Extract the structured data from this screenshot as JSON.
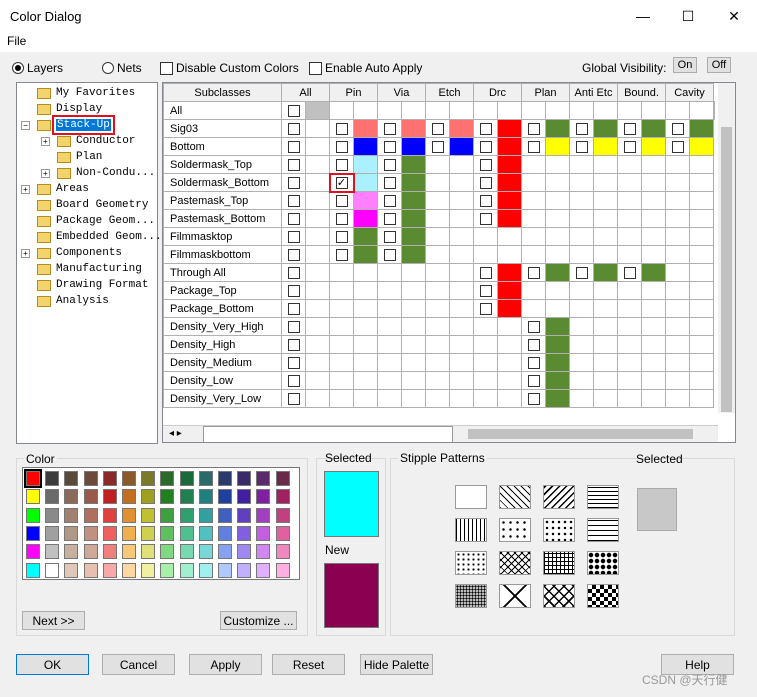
{
  "window": {
    "title": "Color Dialog",
    "menu_file": "File",
    "min": "—",
    "max": "☐",
    "close": "✕"
  },
  "options": {
    "layers": "Layers",
    "nets": "Nets",
    "disable_custom_colors": "Disable Custom Colors",
    "enable_auto_apply": "Enable Auto Apply",
    "global_visibility": "Global Visibility:",
    "on": "On",
    "off": "Off"
  },
  "tree": [
    {
      "label": "My Favorites",
      "indent": 0,
      "exp": ""
    },
    {
      "label": "Display",
      "indent": 0,
      "exp": ""
    },
    {
      "label": "Stack-Up",
      "indent": 0,
      "exp": "−",
      "selected": true
    },
    {
      "label": "Conductor",
      "indent": 1,
      "exp": "+"
    },
    {
      "label": "Plan",
      "indent": 1,
      "exp": ""
    },
    {
      "label": "Non-Condu...",
      "indent": 1,
      "exp": "+"
    },
    {
      "label": "Areas",
      "indent": 0,
      "exp": "+"
    },
    {
      "label": "Board Geometry",
      "indent": 0,
      "exp": ""
    },
    {
      "label": "Package Geom...",
      "indent": 0,
      "exp": ""
    },
    {
      "label": "Embedded Geom...",
      "indent": 0,
      "exp": ""
    },
    {
      "label": "Components",
      "indent": 0,
      "exp": "+"
    },
    {
      "label": "Manufacturing",
      "indent": 0,
      "exp": ""
    },
    {
      "label": "Drawing Format",
      "indent": 0,
      "exp": ""
    },
    {
      "label": "Analysis",
      "indent": 0,
      "exp": ""
    }
  ],
  "columns": [
    "Subclasses",
    "All",
    "Pin",
    "Via",
    "Etch",
    "Drc",
    "Plan",
    "Anti Etc",
    "Bound.",
    "Cavity"
  ],
  "rows": [
    {
      "name": "All",
      "cells": [
        "cb",
        "grey",
        "",
        "",
        "",
        "",
        "",
        "",
        "",
        "",
        "",
        "",
        "",
        "",
        "",
        "",
        "",
        "",
        ""
      ]
    },
    {
      "name": "Sig03",
      "cells": [
        "cb",
        "",
        "cb",
        "#ff7070",
        "cb",
        "#ff7070",
        "cb",
        "#ff7070",
        "cb",
        "#ff0000",
        "cb",
        "#5a8a32",
        "cb",
        "#5a8a32",
        "cb",
        "#5a8a32",
        "cb",
        "#5a8a32"
      ]
    },
    {
      "name": "Bottom",
      "cells": [
        "cb",
        "",
        "cb",
        "#0000ff",
        "cb",
        "#0000ff",
        "cb",
        "#0000ff",
        "cb",
        "#ff0000",
        "cb",
        "#ffff00",
        "cb",
        "#ffff00",
        "cb",
        "#ffff00",
        "cb",
        "#ffff00"
      ]
    },
    {
      "name": "Soldermask_Top",
      "cells": [
        "cb",
        "",
        "cb",
        "#aaf0ff",
        "cb",
        "#5a8a32",
        "",
        "",
        "cb",
        "#ff0000",
        "",
        "",
        "",
        "",
        "",
        "",
        "",
        ""
      ]
    },
    {
      "name": "Soldermask_Bottom",
      "cells": [
        "cb",
        "",
        "ck",
        "#aaf0ff",
        "cb",
        "#5a8a32",
        "",
        "",
        "cb",
        "#ff0000",
        "",
        "",
        "",
        "",
        "",
        "",
        "",
        ""
      ]
    },
    {
      "name": "Pastemask_Top",
      "cells": [
        "cb",
        "",
        "cb",
        "#ff80ff",
        "cb",
        "#5a8a32",
        "",
        "",
        "cb",
        "#ff0000",
        "",
        "",
        "",
        "",
        "",
        "",
        "",
        ""
      ]
    },
    {
      "name": "Pastemask_Bottom",
      "cells": [
        "cb",
        "",
        "cb",
        "#ff00ff",
        "cb",
        "#5a8a32",
        "",
        "",
        "cb",
        "#ff0000",
        "",
        "",
        "",
        "",
        "",
        "",
        "",
        ""
      ]
    },
    {
      "name": "Filmmasktop",
      "cells": [
        "cb",
        "",
        "cb",
        "#5a8a32",
        "cb",
        "#5a8a32",
        "",
        "",
        "",
        "",
        "",
        "",
        "",
        "",
        "",
        "",
        "",
        ""
      ]
    },
    {
      "name": "Filmmaskbottom",
      "cells": [
        "cb",
        "",
        "cb",
        "#5a8a32",
        "cb",
        "#5a8a32",
        "",
        "",
        "",
        "",
        "",
        "",
        "",
        "",
        "",
        "",
        "",
        ""
      ]
    },
    {
      "name": "Through All",
      "cells": [
        "cb",
        "",
        "",
        "",
        "",
        "",
        "",
        "",
        "cb",
        "#ff0000",
        "cb",
        "#5a8a32",
        "cb",
        "#5a8a32",
        "cb",
        "#5a8a32",
        "",
        ""
      ]
    },
    {
      "name": "Package_Top",
      "cells": [
        "cb",
        "",
        "",
        "",
        "",
        "",
        "",
        "",
        "cb",
        "#ff0000",
        "",
        "",
        "",
        "",
        "",
        "",
        "",
        ""
      ]
    },
    {
      "name": "Package_Bottom",
      "cells": [
        "cb",
        "",
        "",
        "",
        "",
        "",
        "",
        "",
        "cb",
        "#ff0000",
        "",
        "",
        "",
        "",
        "",
        "",
        "",
        ""
      ]
    },
    {
      "name": "Density_Very_High",
      "cells": [
        "cb",
        "",
        "",
        "",
        "",
        "",
        "",
        "",
        "",
        "",
        "cb",
        "#5a8a32",
        "",
        "",
        "",
        "",
        "",
        ""
      ]
    },
    {
      "name": "Density_High",
      "cells": [
        "cb",
        "",
        "",
        "",
        "",
        "",
        "",
        "",
        "",
        "",
        "cb",
        "#5a8a32",
        "",
        "",
        "",
        "",
        "",
        ""
      ]
    },
    {
      "name": "Density_Medium",
      "cells": [
        "cb",
        "",
        "",
        "",
        "",
        "",
        "",
        "",
        "",
        "",
        "cb",
        "#5a8a32",
        "",
        "",
        "",
        "",
        "",
        ""
      ]
    },
    {
      "name": "Density_Low",
      "cells": [
        "cb",
        "",
        "",
        "",
        "",
        "",
        "",
        "",
        "",
        "",
        "cb",
        "#5a8a32",
        "",
        "",
        "",
        "",
        "",
        ""
      ]
    },
    {
      "name": "Density_Very_Low",
      "cells": [
        "cb",
        "",
        "",
        "",
        "",
        "",
        "",
        "",
        "",
        "",
        "cb",
        "#5a8a32",
        "",
        "",
        "",
        "",
        "",
        ""
      ]
    }
  ],
  "palette": {
    "title": "Color",
    "colors": [
      "#ff0000",
      "#3c3c3c",
      "#5a4a3a",
      "#6e4a3a",
      "#8a2a2a",
      "#8a5a2a",
      "#7a7a2a",
      "#2a6a2a",
      "#1a6a3a",
      "#2a6a6a",
      "#2a3a6a",
      "#3a2a6a",
      "#5a2a6a",
      "#6a2a4a",
      "#ffff00",
      "#6a6a6a",
      "#8a6a5a",
      "#9a5a4a",
      "#c02020",
      "#c07020",
      "#a0a020",
      "#208020",
      "#208050",
      "#208080",
      "#2040a0",
      "#4020a0",
      "#8020a0",
      "#a02060",
      "#00ff00",
      "#8a8a8a",
      "#a08070",
      "#b07060",
      "#e04040",
      "#e09030",
      "#c0c030",
      "#40a040",
      "#30a070",
      "#30a0a0",
      "#4060c0",
      "#6040c0",
      "#a040c0",
      "#c04080",
      "#0000ff",
      "#a0a0a0",
      "#b09888",
      "#c09080",
      "#f06060",
      "#f0b050",
      "#d0d050",
      "#60c060",
      "#50c090",
      "#50c0c0",
      "#6080e0",
      "#8060e0",
      "#c060e0",
      "#e060a0",
      "#ff00ff",
      "#c0c0c0",
      "#c8b0a0",
      "#d0a898",
      "#f08080",
      "#f8c878",
      "#e0e078",
      "#80d880",
      "#78d8b0",
      "#78d8d8",
      "#88a0f0",
      "#a088f0",
      "#d088f0",
      "#f088c0",
      "#00ffff",
      "#ffffff",
      "#e0c8b8",
      "#e8c0b0",
      "#f8a8a8",
      "#fcd8a0",
      "#f0f0a0",
      "#a8f0a8",
      "#a0f0d0",
      "#a0f0f0",
      "#b0c8ff",
      "#c0b0ff",
      "#e0b0ff",
      "#ffb0e0"
    ],
    "next": "Next >>",
    "customize": "Customize ...",
    "selected": "Selected",
    "new": "New",
    "selected_color": "#00ffff",
    "new_color": "#8b0050"
  },
  "stipple": {
    "title": "Stipple Patterns",
    "selected": "Selected"
  },
  "buttons": {
    "ok": "OK",
    "cancel": "Cancel",
    "apply": "Apply",
    "reset": "Reset",
    "hide_palette": "Hide Palette",
    "help": "Help"
  },
  "watermark": "CSDN @天行健"
}
